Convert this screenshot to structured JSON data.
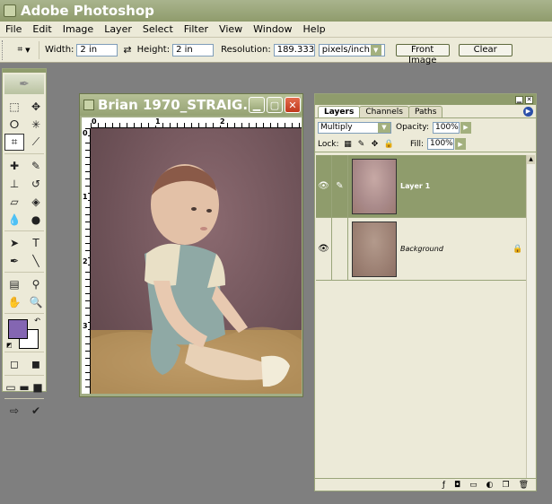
{
  "app": {
    "title": "Adobe Photoshop"
  },
  "menu": [
    "File",
    "Edit",
    "Image",
    "Layer",
    "Select",
    "Filter",
    "View",
    "Window",
    "Help"
  ],
  "options": {
    "width_label": "Width:",
    "width_value": "2 in",
    "height_label": "Height:",
    "height_value": "2 in",
    "resolution_label": "Resolution:",
    "resolution_value": "189.333",
    "resolution_unit": "pixels/inch",
    "front_image": "Front Image",
    "clear": "Clear"
  },
  "toolbox": {
    "foreground_color": "#8466b2",
    "background_color": "#ffffff"
  },
  "document": {
    "title": "Brian 1970_STRAIG...",
    "ruler_labels": [
      "0",
      "1",
      "2"
    ],
    "ruler_left_labels": [
      "0",
      "1",
      "2",
      "3"
    ]
  },
  "layers_palette": {
    "tabs": [
      "Layers",
      "Channels",
      "Paths"
    ],
    "blend_mode": "Multiply",
    "opacity_label": "Opacity:",
    "opacity_value": "100%",
    "lock_label": "Lock:",
    "fill_label": "Fill:",
    "fill_value": "100%",
    "layers": [
      {
        "name": "Layer 1",
        "selected": true
      },
      {
        "name": "Background",
        "selected": false
      }
    ]
  }
}
